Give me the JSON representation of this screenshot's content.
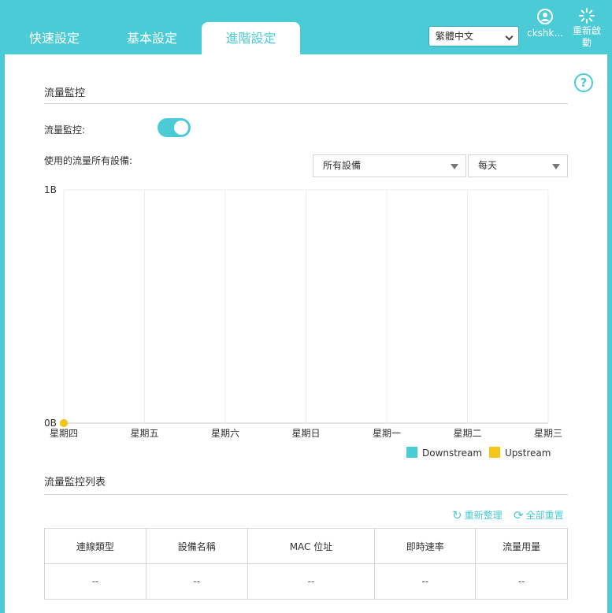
{
  "tabs": [
    {
      "label": "快速設定",
      "active": false
    },
    {
      "label": "基本設定",
      "active": false
    },
    {
      "label": "進階設定",
      "active": true
    }
  ],
  "language": {
    "selected": "繁體中文"
  },
  "user": {
    "name": "ckshk...",
    "icon": "user-circle-icon"
  },
  "reboot": {
    "label": "重新啟動",
    "icon": "spinner-icon"
  },
  "help": {
    "icon": "question-icon",
    "glyph": "?"
  },
  "monitor": {
    "section_title": "流量監控",
    "toggle_label": "流量監控:",
    "toggle_on": true,
    "usage_label": "使用的流量所有設備:",
    "device_select": "所有設備",
    "period_select": "每天"
  },
  "chart_data": {
    "type": "line",
    "categories": [
      "星期四",
      "星期五",
      "星期六",
      "星期日",
      "星期一",
      "星期二",
      "星期三"
    ],
    "y_ticks": [
      "1B",
      "0B"
    ],
    "ylim": [
      0,
      1
    ],
    "series": [
      {
        "name": "Downstream",
        "color": "#4acbd6",
        "values": [
          0
        ]
      },
      {
        "name": "Upstream",
        "color": "#f5c518",
        "values": [
          0
        ]
      }
    ],
    "grid": true,
    "legend": "bottom-right"
  },
  "list": {
    "section_title": "流量監控列表",
    "refresh_label": "重新整理",
    "reset_label": "全部重置",
    "columns": [
      "連線類型",
      "設備名稱",
      "MAC 位址",
      "即時速率",
      "流量用量"
    ],
    "rows": [
      [
        "--",
        "--",
        "--",
        "--",
        "--"
      ]
    ]
  },
  "colors": {
    "accent": "#4acbd6",
    "upstream": "#f5c518"
  }
}
